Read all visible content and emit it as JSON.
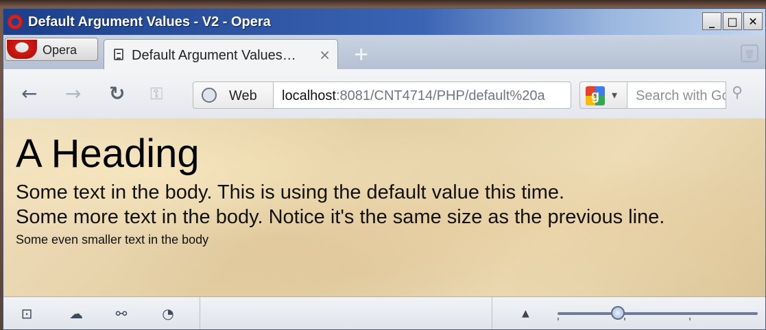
{
  "window": {
    "title": "Default Argument Values - V2 - Opera",
    "controls": {
      "minimize": "_",
      "maximize": "□",
      "close": "✕"
    }
  },
  "tabbar": {
    "menu_label": "Opera",
    "active_tab": {
      "title": "Default Argument Values…",
      "close": "×"
    },
    "new_tab": "+",
    "trash": "🗑"
  },
  "navbar": {
    "back": "←",
    "forward": "→",
    "reload": "↻",
    "key": "⚿",
    "site_label": "Web",
    "url_host": "localhost",
    "url_path": ":8081/CNT4714/PHP/default%20a",
    "search_engine": "g",
    "search_placeholder": "Search with Google",
    "search_icon": "⚲"
  },
  "page": {
    "heading": "A Heading",
    "line1": "Some text in the body. This is using the default value this time.",
    "line2": "Some more text in the body. Notice it's the same size as the previous line.",
    "line3": "Some even smaller text in the body"
  },
  "statusbar": {
    "icons": [
      "panel-toggle-icon",
      "cloud-icon",
      "share-icon",
      "speed-dial-icon"
    ],
    "zoom_caret": "▲",
    "zoom_level_fraction": 0.3
  },
  "colors": {
    "titlebar": "#1d3f8a",
    "opera_red": "#d11a12",
    "page_background": "#e8d6ad"
  }
}
